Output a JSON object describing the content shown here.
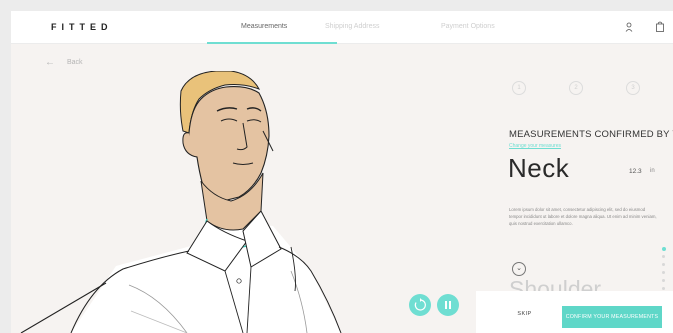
{
  "brand": {
    "logo": "FITTED",
    "accent_color": "#6fded2"
  },
  "nav": {
    "links": [
      {
        "label": "Measurements",
        "active": true
      },
      {
        "label": "Shipping Address",
        "active": false
      },
      {
        "label": "Payment Options",
        "active": false
      }
    ],
    "icons": [
      "user-icon",
      "shopping-bag-icon"
    ]
  },
  "back": {
    "label": "Back"
  },
  "steps": [
    "1",
    "2",
    "3"
  ],
  "panel": {
    "title": "MEASUREMENTS CONFIRMED BY YOU",
    "link": "Change your measures",
    "current": {
      "name": "Neck",
      "value": "12.3",
      "unit": "in"
    },
    "description": "Lorem ipsum dolor sit amet, consectetur adipiscing elit, sed do eiusmod tempor incididunt ut labore et dolore magna aliqua. Ut enim ad minim veniam, quis nostrud exercitation ullamco.",
    "next": {
      "name": "Shoulder"
    }
  },
  "progress": {
    "total": 8,
    "active_index": 0
  },
  "footer": {
    "skip_label": "SKIP",
    "confirm_label": "CONFIRM YOUR MEASUREMENTS"
  },
  "media_controls": [
    "replay-icon",
    "pause-icon"
  ]
}
